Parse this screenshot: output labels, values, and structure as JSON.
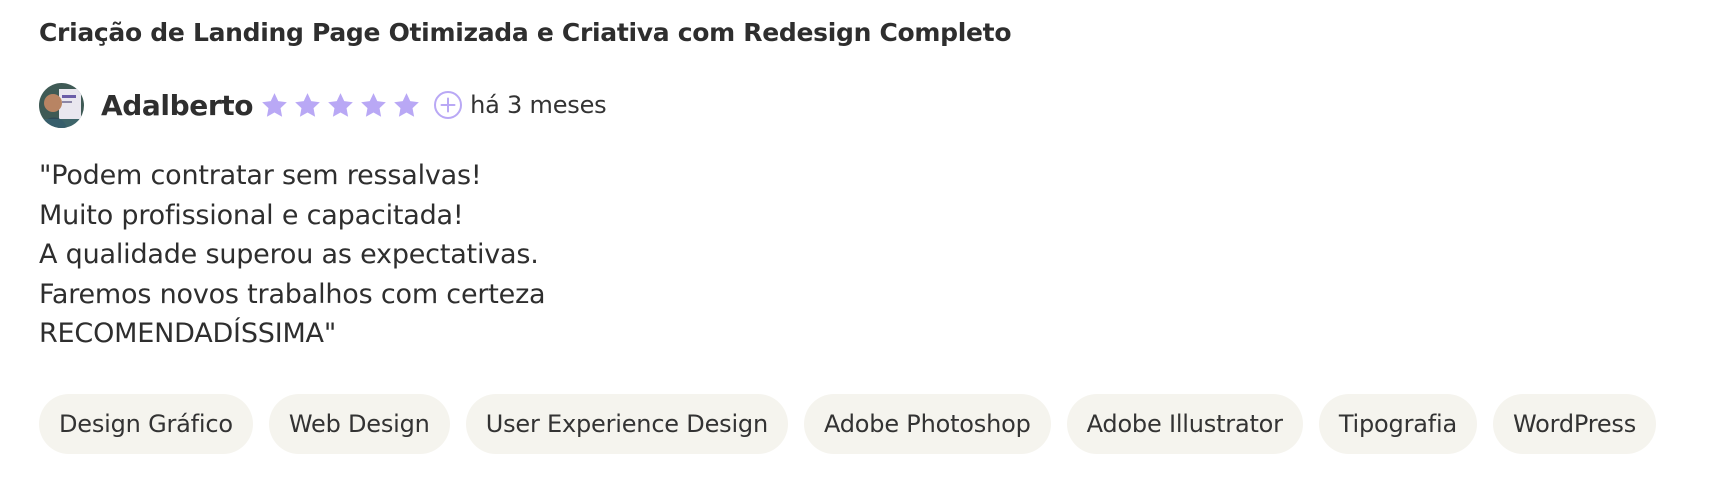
{
  "review": {
    "title": "Criação de Landing Page Otimizada e Criativa com Redesign Completo",
    "author": "Adalberto",
    "rating": 5,
    "rating_max": 5,
    "time_ago": "há 3 meses",
    "comment_lines": [
      "\"Podem contratar sem ressalvas!",
      "Muito profissional e capacitada!",
      "A qualidade superou as expectativas.",
      "Faremos novos trabalhos com certeza",
      "RECOMENDADÍSSIMA\""
    ],
    "tags": [
      "Design Gráfico",
      "Web Design",
      "User Experience Design",
      "Adobe Photoshop",
      "Adobe Illustrator",
      "Tipografia",
      "WordPress"
    ]
  },
  "icons": {
    "star": "star-icon",
    "more": "plus-circle-icon",
    "avatar": "user-avatar"
  },
  "colors": {
    "star": "#b9a8f5",
    "tag_background": "#f5f4ee",
    "text": "#2e2e2e"
  }
}
